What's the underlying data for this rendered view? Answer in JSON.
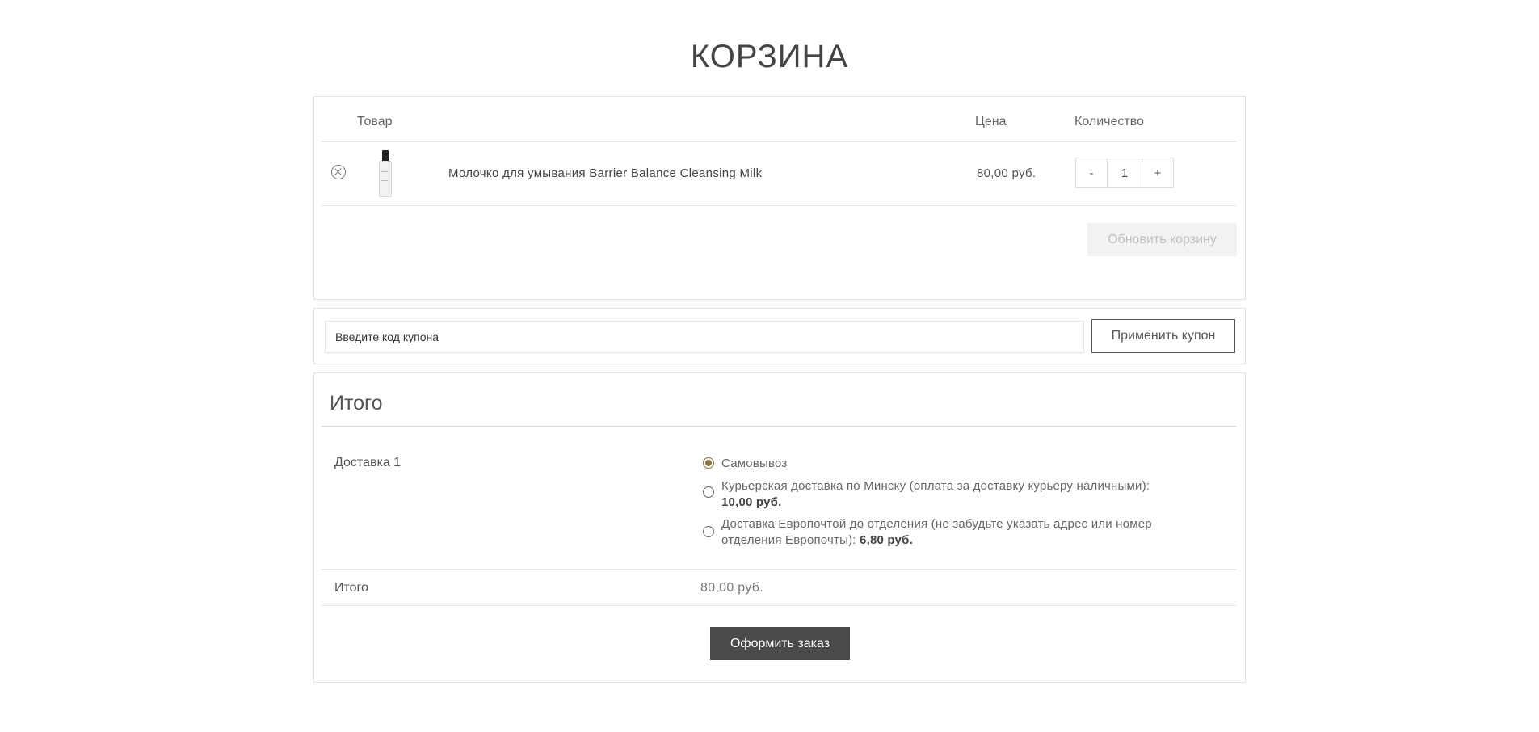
{
  "page": {
    "title": "КОРЗИНА"
  },
  "cart": {
    "headers": {
      "product": "Товар",
      "price": "Цена",
      "quantity": "Количество"
    },
    "items": [
      {
        "name": "Молочко для умывания Barrier Balance Cleansing Milk",
        "price": "80,00 руб.",
        "quantity": "1"
      }
    ],
    "qty_minus": "-",
    "qty_plus": "+",
    "update_button": "Обновить корзину"
  },
  "coupon": {
    "placeholder": "Введите код купона",
    "apply_button": "Применить купон"
  },
  "totals": {
    "title": "Итого",
    "shipping_label": "Доставка 1",
    "shipping_options": [
      {
        "label": "Самовывоз",
        "cost": "",
        "selected": true
      },
      {
        "label": "Курьерская доставка по Минску (оплата за доставку курьеру наличными):",
        "cost": "10,00 руб.",
        "selected": false
      },
      {
        "label": "Доставка Европочтой до отделения (не забудьте указать адрес или номер отделения Европочты):",
        "cost": "6,80 руб.",
        "selected": false
      }
    ],
    "total_label": "Итого",
    "total_value": "80,00 руб.",
    "checkout_button": "Оформить заказ"
  },
  "colors": {
    "accent": "#8a7440",
    "checkout_bg": "#4a4a4a"
  },
  "icons": {
    "remove": "remove-circle-x-icon",
    "product_image": "product-bottle-thumbnail"
  }
}
